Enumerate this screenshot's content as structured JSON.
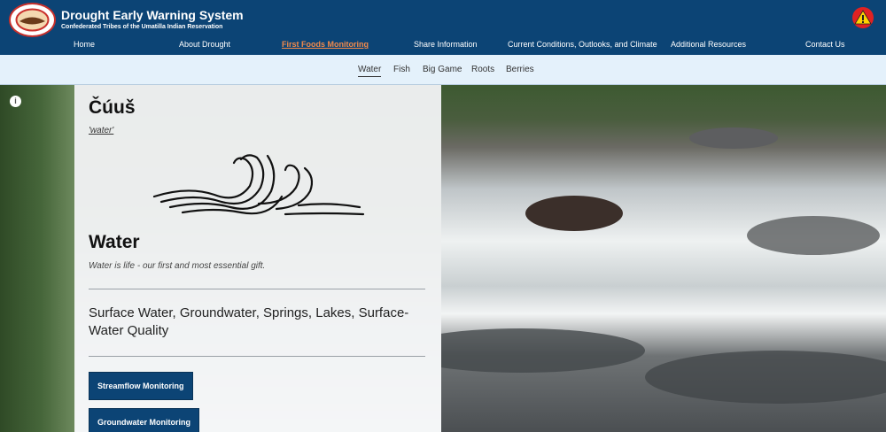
{
  "header": {
    "title": "Drought Early Warning System",
    "subtitle": "Confederated Tribes of the Umatilla Indian Reservation",
    "alert_icon": "warning-icon"
  },
  "nav": {
    "items": [
      {
        "label": "Home"
      },
      {
        "label": "About Drought"
      },
      {
        "label": "First Foods Monitoring"
      },
      {
        "label": "Share Information"
      },
      {
        "label": "Current Conditions, Outlooks, and Climate"
      },
      {
        "label": "Additional Resources"
      },
      {
        "label": "Contact Us"
      }
    ],
    "active_color": "#f38a4a"
  },
  "subnav": {
    "items": [
      {
        "label": "Water"
      },
      {
        "label": "Fish"
      },
      {
        "label": "Big Game"
      },
      {
        "label": "Roots"
      },
      {
        "label": "Berries"
      }
    ]
  },
  "panel": {
    "native_word": "Čúuš",
    "translation": "'water'",
    "heading": "Water",
    "tagline": "Water is life - our first and most essential gift.",
    "topics": "Surface Water, Groundwater, Springs, Lakes, Surface-Water Quality",
    "buttons": [
      {
        "label": "Streamflow Monitoring"
      },
      {
        "label": "Groundwater Monitoring"
      }
    ]
  },
  "colors": {
    "brand": "#0c4475",
    "subnav_bg": "#e4f1fb"
  }
}
